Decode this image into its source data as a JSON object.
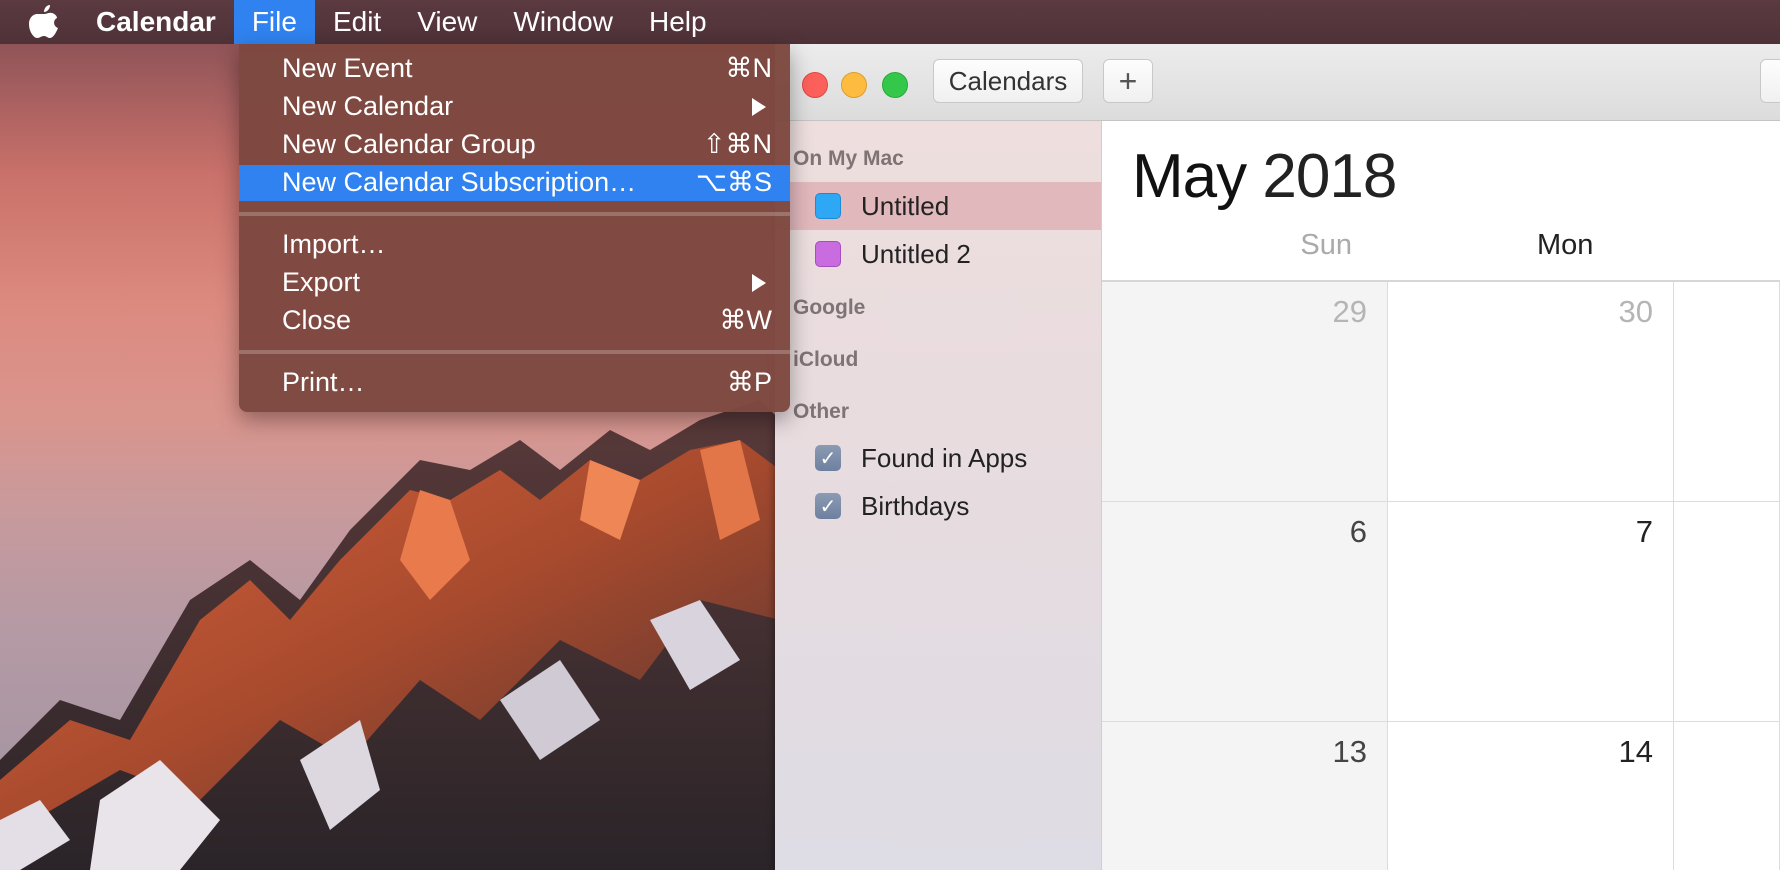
{
  "menubar": {
    "app_name": "Calendar",
    "items": [
      "File",
      "Edit",
      "View",
      "Window",
      "Help"
    ],
    "active": "File"
  },
  "file_menu": {
    "items": [
      {
        "label": "New Event",
        "shortcut": "⌘N"
      },
      {
        "label": "New Calendar",
        "submenu": true
      },
      {
        "label": "New Calendar Group",
        "shortcut": "⇧⌘N"
      },
      {
        "label": "New Calendar Subscription…",
        "shortcut": "⌥⌘S",
        "highlighted": true
      },
      {
        "label": "Import…"
      },
      {
        "label": "Export",
        "submenu": true
      },
      {
        "label": "Close",
        "shortcut": "⌘W"
      },
      {
        "label": "Print…",
        "shortcut": "⌘P"
      }
    ]
  },
  "toolbar": {
    "calendars_label": "Calendars",
    "add_label": "+"
  },
  "sidebar": {
    "groups": [
      {
        "header": "On My Mac",
        "calendars": [
          {
            "name": "Untitled",
            "color": "#2ea8f5",
            "selected": true
          },
          {
            "name": "Untitled 2",
            "color": "#c86cdf"
          }
        ]
      },
      {
        "header": "Google",
        "calendars": []
      },
      {
        "header": "iCloud",
        "calendars": []
      },
      {
        "header": "Other",
        "calendars": [
          {
            "name": "Found in Apps",
            "checked": true
          },
          {
            "name": "Birthdays",
            "checked": true
          }
        ]
      }
    ]
  },
  "month_view": {
    "month": "May",
    "year": "2018",
    "weekdays": [
      "Sun",
      "Mon"
    ],
    "weeks": [
      [
        "29",
        "30"
      ],
      [
        "6",
        "7"
      ],
      [
        "13",
        "14"
      ]
    ]
  },
  "colors": {
    "menu_highlight": "#2f82ef",
    "close": "#fc605b",
    "minimize": "#fdbc40",
    "maximize": "#34c84a"
  }
}
